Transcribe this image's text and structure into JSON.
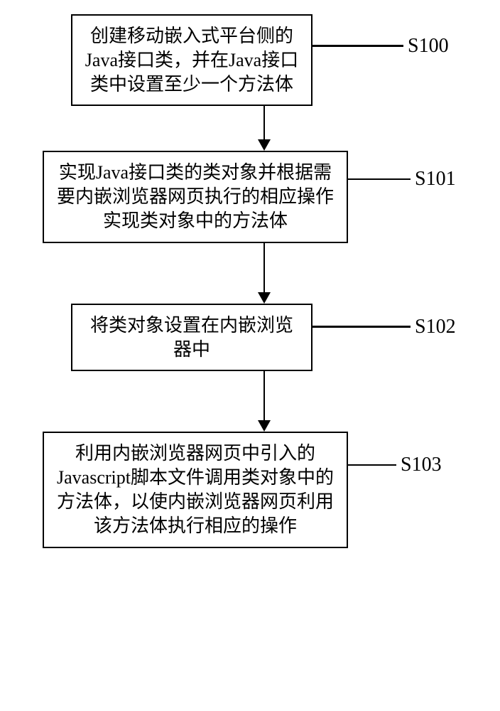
{
  "flowchart": {
    "steps": [
      {
        "id": "s100",
        "label": "S100",
        "text": "创建移动嵌入式平台侧的Java接口类，并在Java接口类中设置至少一个方法体"
      },
      {
        "id": "s101",
        "label": "S101",
        "text": "实现Java接口类的类对象并根据需要内嵌浏览器网页执行的相应操作实现类对象中的方法体"
      },
      {
        "id": "s102",
        "label": "S102",
        "text": "将类对象设置在内嵌浏览器中"
      },
      {
        "id": "s103",
        "label": "S103",
        "text": "利用内嵌浏览器网页中引入的Javascript脚本文件调用类对象中的方法体，以使内嵌浏览器网页利用该方法体执行相应的操作"
      }
    ]
  }
}
